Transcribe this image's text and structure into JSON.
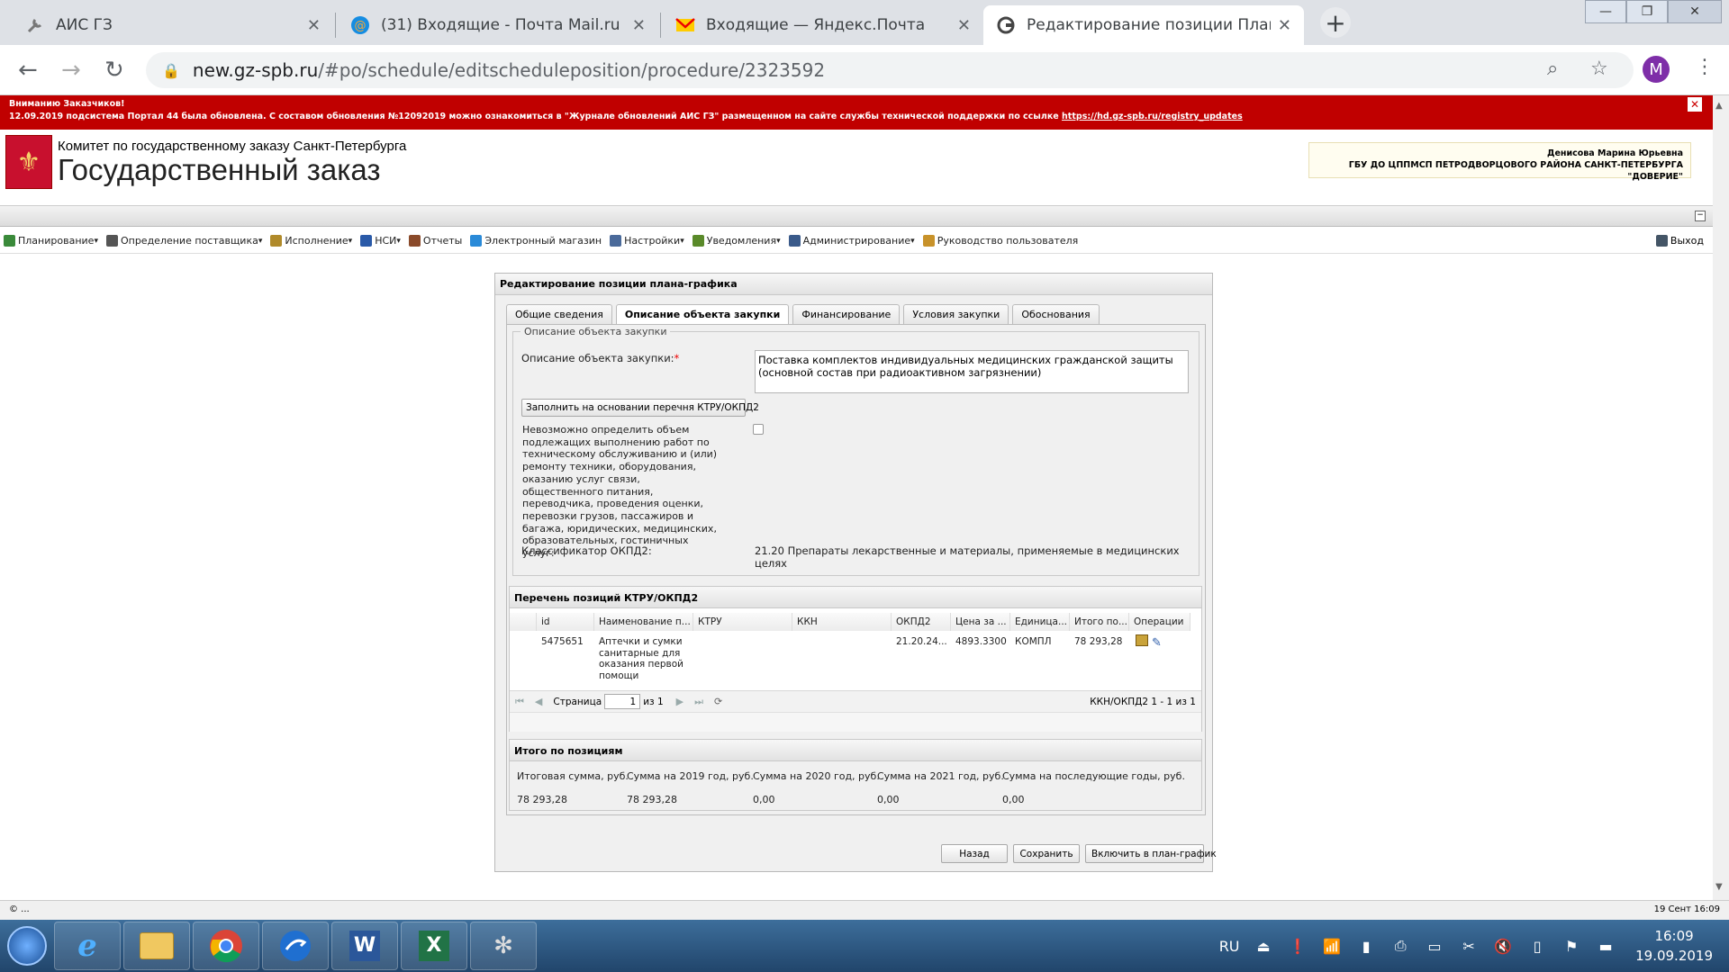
{
  "browser": {
    "tabs": [
      {
        "title": "АИС ГЗ",
        "icon": "wrench-icon"
      },
      {
        "title": "(31) Входящие - Почта Mail.ru",
        "icon": "mail-at-icon"
      },
      {
        "title": "Входящие — Яндекс.Почта",
        "icon": "yandex-mail-icon"
      },
      {
        "title": "Редактирование позиции Плана-графика",
        "icon": "globe-icon"
      }
    ],
    "url_host": "new.gz-spb.ru",
    "url_path": "/#po/schedule/editscheduleposition/procedure/2323592",
    "profile_letter": "M"
  },
  "notice": {
    "line1": "Вниманию Заказчиков!",
    "line2": "12.09.2019 подсистема Портал 44 была обновлена. С составом обновления №12092019 можно ознакомиться в \"Журнале обновлений АИС ГЗ\" размещенном на сайте службы технической поддержки по ссылке ",
    "link": "https://hd.gz-spb.ru/registry_updates",
    "close": "✕"
  },
  "header": {
    "org_line1": "Комитет по государственному заказу Санкт-Петербурга",
    "org_line2": "Государственный заказ",
    "user_name": "Денисова Марина Юрьевна",
    "user_org": "ГБУ ДО ЦППМСП ПЕТРОДВОРЦОВОГО РАЙОНА САНКТ-ПЕТЕРБУРГА \"ДОВЕРИЕ\""
  },
  "menu": {
    "items": [
      {
        "label": "Планирование",
        "dropdown": true,
        "color": "#3a8a3a"
      },
      {
        "label": "Определение поставщика",
        "dropdown": true,
        "color": "#555"
      },
      {
        "label": "Исполнение",
        "dropdown": true,
        "color": "#b08a2a"
      },
      {
        "label": "НСИ",
        "dropdown": true,
        "color": "#2a5aa8"
      },
      {
        "label": "Отчеты",
        "dropdown": false,
        "color": "#8a4a2a"
      },
      {
        "label": "Электронный магазин",
        "dropdown": false,
        "color": "#2a8ad8"
      },
      {
        "label": "Настройки",
        "dropdown": true,
        "color": "#4a6a9a"
      },
      {
        "label": "Уведомления",
        "dropdown": true,
        "color": "#5a8a2a"
      },
      {
        "label": "Администрирование",
        "dropdown": true,
        "color": "#3a5a8a"
      },
      {
        "label": "Руководство пользователя",
        "dropdown": false,
        "color": "#c8922a"
      }
    ],
    "exit_label": "Выход"
  },
  "panel": {
    "title": "Редактирование позиции плана-графика",
    "tabs": [
      "Общие сведения",
      "Описание объекта закупки",
      "Финансирование",
      "Условия закупки",
      "Обоснования"
    ],
    "active_tab": 1,
    "fieldset_legend": "Описание объекта закупки",
    "desc_label": "Описание объекта закупки:",
    "desc_value": "Поставка комплектов индивидуальных медицинских гражданской защиты (основной состав при радиоактивном загрязнении)",
    "fill_button": "Заполнить на основании перечня КТРУ/ОКПД2",
    "checkbox_label": "Невозможно определить объем подлежащих выполнению работ по техническому обслуживанию и (или) ремонту техники, оборудования, оказанию услуг связи, общественного питания, переводчика, проведения оценки, перевозки грузов, пассажиров и багажа, юридических, медицинских, образовательных, гостиничных услуг:",
    "checkbox_checked": false,
    "okpd_label": "Классификатор ОКПД2:",
    "okpd_value": "21.20 Препараты лекарственные и материалы, применяемые в медицинских целях"
  },
  "grid": {
    "title": "Перечень позиций КТРУ/ОКПД2",
    "columns": [
      "id",
      "Наименование п...",
      "КТРУ",
      "ККН",
      "ОКПД2",
      "Цена за ...",
      "Единица...",
      "Итого по...",
      "Операции"
    ],
    "rows": [
      {
        "id": "5475651",
        "name": "Аптечки и сумки санитарные для оказания первой помощи",
        "ktru": "",
        "kkn": "",
        "okpd2": "21.20.24...",
        "price": "4893.3300",
        "unit": "КОМПЛ",
        "total": "78 293,28"
      }
    ],
    "pager": {
      "page_label": "Страница",
      "page": "1",
      "of": "из 1",
      "summary": "ККН/ОКПД2 1 - 1 из 1"
    }
  },
  "totals": {
    "title": "Итого по позициям",
    "headers": [
      "Итоговая сумма, руб.",
      "Сумма на 2019 год, руб.",
      "Сумма на 2020 год, руб.",
      "Сумма на 2021 год, руб.",
      "Сумма на последующие годы, руб."
    ],
    "values": [
      "78 293,28",
      "78 293,28",
      "0,00",
      "0,00",
      "0,00"
    ]
  },
  "actions": {
    "back": "Назад",
    "save": "Сохранить",
    "include": "Включить в план-график"
  },
  "statusbar": {
    "left": "© ...",
    "right": "19 Сент 16:09"
  },
  "taskbar": {
    "lang": "RU",
    "time": "16:09",
    "date": "19.09.2019"
  }
}
